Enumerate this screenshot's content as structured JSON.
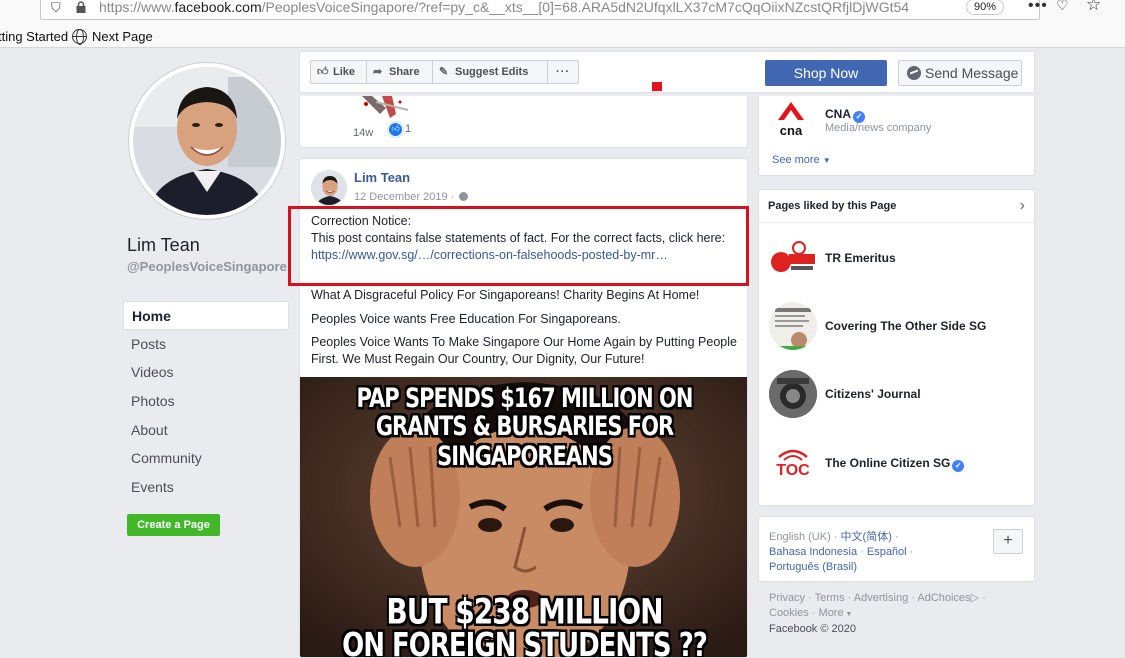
{
  "browser": {
    "url_prefix": "https://www.",
    "url_domain": "facebook.com",
    "url_rest": "/PeoplesVoiceSingapore/?ref=py_c&__xts__[0]=68.ARA5dN2UfqxlLX37cM7cQqOiixNZcstQRfjlDjWGt54",
    "zoom": "90%",
    "bookmarks": [
      "tting Started",
      "Next Page"
    ]
  },
  "sidebar": {
    "name": "Lim Tean",
    "handle": "@PeoplesVoiceSingapore",
    "nav": [
      "Home",
      "Posts",
      "Videos",
      "Photos",
      "About",
      "Community",
      "Events"
    ],
    "create_page": "Create a Page"
  },
  "action_bar": {
    "like": "Like",
    "share": "Share",
    "suggest": "Suggest Edits",
    "more": "···",
    "shop_now": "Shop Now",
    "send_message": "Send Message"
  },
  "prev_post": {
    "time": "14w",
    "reactions": "1"
  },
  "post": {
    "author": "Lim Tean",
    "date": "12 December 2019 ·",
    "correction_title": "Correction Notice:",
    "correction_body": "This post contains false statements of fact. For the correct facts, click here:",
    "correction_link": "https://www.gov.sg/…/corrections-on-falsehoods-posted-by-mr…",
    "paragraphs": [
      "What A Disgraceful Policy For Singaporeans! Charity Begins At Home!",
      "Peoples Voice wants Free Education For Singaporeans.",
      "Peoples Voice Wants To Make Singapore Our Home Again by Putting People First. We Must Regain Our Country, Our Dignity, Our Future!"
    ],
    "meme": {
      "top_line1": "PAP SPENDS $167 MILLION ON",
      "top_line2": "GRANTS & BURSARIES FOR SINGAPOREANS",
      "bottom_line1": "BUT $238 MILLION",
      "bottom_line2": "ON FOREIGN STUDENTS ??"
    }
  },
  "right": {
    "cna": {
      "name": "CNA",
      "category": "Media/news company",
      "see_more": "See more"
    },
    "liked_header": "Pages liked by this Page",
    "liked_pages": [
      "TR Emeritus",
      "Covering The Other Side SG",
      "Citizens' Journal",
      "The Online Citizen SG"
    ],
    "languages": {
      "current": "English (UK)",
      "others": [
        "中文(简体)",
        "Bahasa Indonesia",
        "Español",
        "Português (Brasil)"
      ]
    },
    "add_language": "+",
    "footer_links": [
      "Privacy",
      "Terms",
      "Advertising",
      "AdChoices",
      "Cookies",
      "More"
    ],
    "copyright": "Facebook © 2020"
  },
  "colors": {
    "fb_blue": "#4267b2",
    "link_blue": "#385898",
    "highlight_red": "#d6121c",
    "create_green": "#42b72a"
  }
}
